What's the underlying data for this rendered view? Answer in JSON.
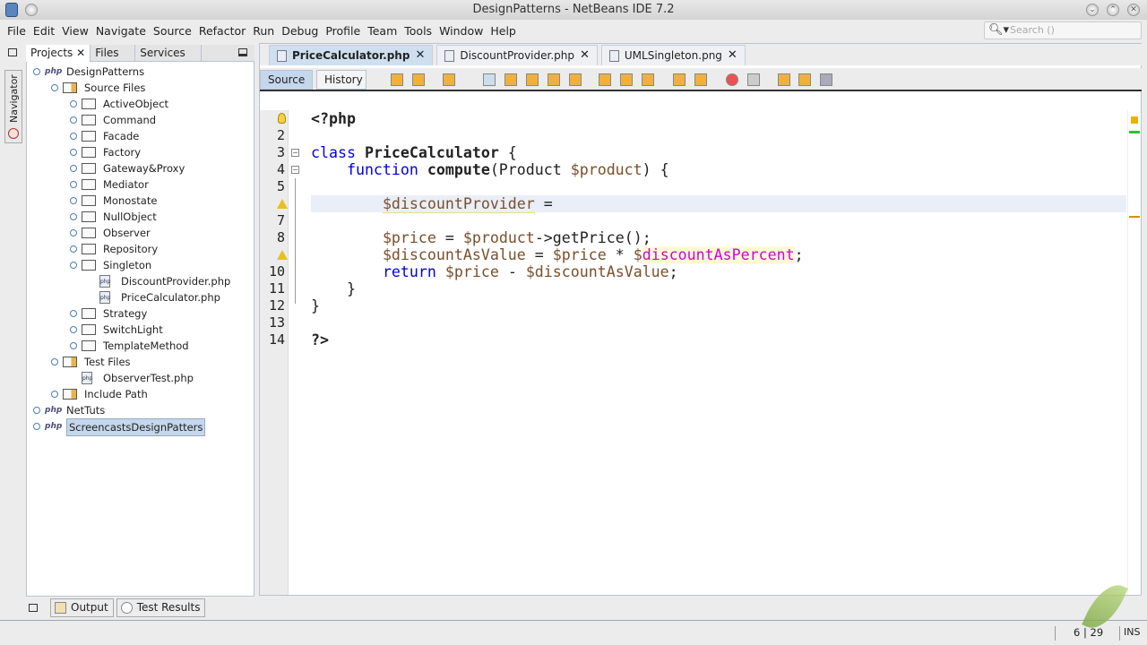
{
  "window": {
    "title": "DesignPatterns - NetBeans IDE 7.2"
  },
  "menubar": [
    "File",
    "Edit",
    "View",
    "Navigate",
    "Source",
    "Refactor",
    "Run",
    "Debug",
    "Profile",
    "Team",
    "Tools",
    "Window",
    "Help"
  ],
  "search": {
    "placeholder": "Search ()"
  },
  "navigator_label": "Navigator",
  "project_tabs": [
    "Projects",
    "Files",
    "Services"
  ],
  "tree": [
    {
      "label": "DesignPatterns",
      "level": 0,
      "icon": "php-project-icon",
      "toggle": true
    },
    {
      "label": "Source Files",
      "level": 1,
      "icon": "source-folder-icon",
      "toggle": true
    },
    {
      "label": "ActiveObject",
      "level": 2,
      "icon": "folder-icon",
      "toggle": true
    },
    {
      "label": "Command",
      "level": 2,
      "icon": "folder-icon",
      "toggle": true
    },
    {
      "label": "Facade",
      "level": 2,
      "icon": "folder-icon",
      "toggle": true
    },
    {
      "label": "Factory",
      "level": 2,
      "icon": "folder-icon",
      "toggle": true
    },
    {
      "label": "Gateway&Proxy",
      "level": 2,
      "icon": "folder-icon",
      "toggle": true
    },
    {
      "label": "Mediator",
      "level": 2,
      "icon": "folder-icon",
      "toggle": true
    },
    {
      "label": "Monostate",
      "level": 2,
      "icon": "folder-icon",
      "toggle": true
    },
    {
      "label": "NullObject",
      "level": 2,
      "icon": "folder-icon",
      "toggle": true
    },
    {
      "label": "Observer",
      "level": 2,
      "icon": "folder-icon",
      "toggle": true
    },
    {
      "label": "Repository",
      "level": 2,
      "icon": "folder-icon",
      "toggle": true
    },
    {
      "label": "Singleton",
      "level": 2,
      "icon": "folder-icon",
      "toggle": true
    },
    {
      "label": "DiscountProvider.php",
      "level": 3,
      "icon": "php-file-icon",
      "toggle": false
    },
    {
      "label": "PriceCalculator.php",
      "level": 3,
      "icon": "php-file-icon",
      "toggle": false
    },
    {
      "label": "Strategy",
      "level": 2,
      "icon": "folder-icon",
      "toggle": true
    },
    {
      "label": "SwitchLight",
      "level": 2,
      "icon": "folder-icon",
      "toggle": true
    },
    {
      "label": "TemplateMethod",
      "level": 2,
      "icon": "folder-icon",
      "toggle": true
    },
    {
      "label": "Test Files",
      "level": 1,
      "icon": "source-folder-icon",
      "toggle": true
    },
    {
      "label": "ObserverTest.php",
      "level": 2,
      "icon": "php-file-icon",
      "toggle": false
    },
    {
      "label": "Include Path",
      "level": 1,
      "icon": "library-icon",
      "toggle": true
    },
    {
      "label": "NetTuts",
      "level": 0,
      "icon": "php-project-icon",
      "toggle": true
    },
    {
      "label": "ScreencastsDesignPatters",
      "level": 0,
      "icon": "php-project-icon",
      "toggle": true,
      "selected": true
    }
  ],
  "editor_tabs": [
    {
      "label": "PriceCalculator.php",
      "active": true
    },
    {
      "label": "DiscountProvider.php",
      "active": false
    },
    {
      "label": "UMLSingleton.png",
      "active": false
    }
  ],
  "editor_toolbar": {
    "source": "Source",
    "history": "History"
  },
  "code": [
    {
      "n": "1",
      "gutter": "bulb",
      "tokens": [
        [
          "<?php",
          "b"
        ]
      ]
    },
    {
      "n": "2",
      "tokens": []
    },
    {
      "n": "3",
      "fold": "−",
      "tokens": [
        [
          "class ",
          "kw"
        ],
        [
          "PriceCalculator",
          "b"
        ],
        [
          " {",
          ""
        ]
      ]
    },
    {
      "n": "4",
      "fold": "−",
      "tokens": [
        [
          "    function ",
          "kw"
        ],
        [
          "compute",
          "b"
        ],
        [
          "(Product ",
          ""
        ],
        [
          "$product",
          "var"
        ],
        [
          ") {",
          ""
        ]
      ]
    },
    {
      "n": "5",
      "tokens": []
    },
    {
      "n": "6",
      "gutter": "warning",
      "current": true,
      "tokens": [
        [
          "        ",
          ""
        ],
        [
          "$discountProvider",
          "var warnv"
        ],
        [
          " =",
          ""
        ]
      ]
    },
    {
      "n": "7",
      "tokens": []
    },
    {
      "n": "8",
      "tokens": [
        [
          "        ",
          ""
        ],
        [
          "$price",
          "var"
        ],
        [
          " = ",
          ""
        ],
        [
          "$product",
          "var"
        ],
        [
          "->getPrice();",
          ""
        ]
      ]
    },
    {
      "n": "9",
      "gutter": "warning",
      "tokens": [
        [
          "        ",
          ""
        ],
        [
          "$discountAsValue",
          "var"
        ],
        [
          " = ",
          ""
        ],
        [
          "$price",
          "var"
        ],
        [
          " * ",
          ""
        ],
        [
          "$",
          "var"
        ],
        [
          "discountAsPercent",
          "undef"
        ],
        [
          ";",
          ""
        ]
      ]
    },
    {
      "n": "10",
      "tokens": [
        [
          "        ",
          ""
        ],
        [
          "return ",
          "kw"
        ],
        [
          "$price",
          "var"
        ],
        [
          " - ",
          ""
        ],
        [
          "$discountAsValue",
          "var"
        ],
        [
          ";",
          ""
        ]
      ]
    },
    {
      "n": "11",
      "tokens": [
        [
          "    }",
          ""
        ]
      ]
    },
    {
      "n": "12",
      "tokens": [
        [
          "}",
          ""
        ]
      ]
    },
    {
      "n": "13",
      "tokens": []
    },
    {
      "n": "14",
      "tokens": [
        [
          "?>",
          "b"
        ]
      ]
    }
  ],
  "bottom_tabs": [
    "Output",
    "Test Results"
  ],
  "status": {
    "position": "6 | 29",
    "mode": "INS"
  }
}
